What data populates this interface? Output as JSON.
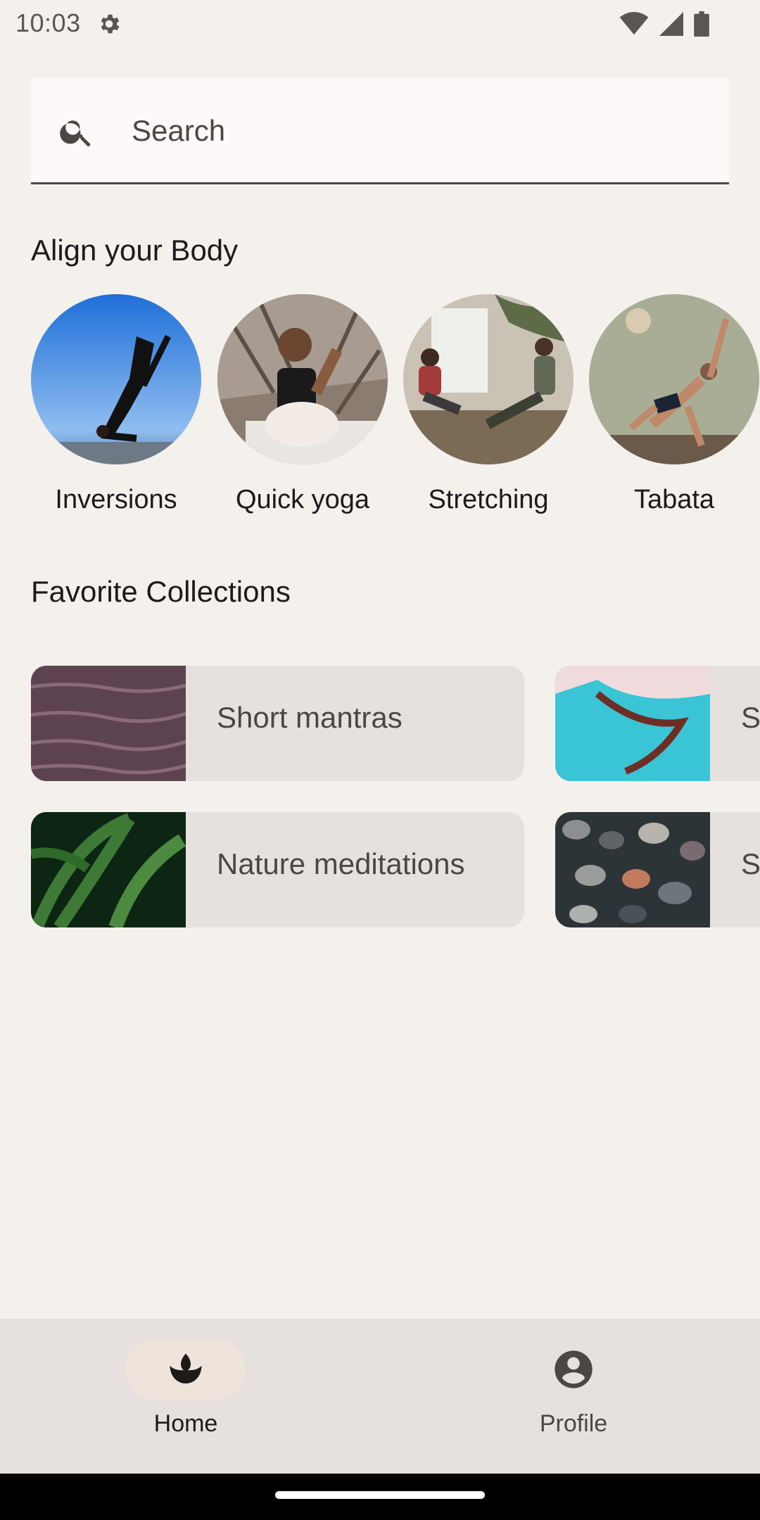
{
  "status_bar": {
    "time": "10:03",
    "icons": [
      "settings-icon",
      "wifi-icon",
      "cell-signal-icon",
      "battery-icon"
    ]
  },
  "search": {
    "placeholder": "Search",
    "value": ""
  },
  "align_section": {
    "title": "Align your Body",
    "items": [
      {
        "label": "Inversions"
      },
      {
        "label": "Quick yoga"
      },
      {
        "label": "Stretching"
      },
      {
        "label": "Tabata"
      }
    ]
  },
  "favorites_section": {
    "title": "Favorite Collections",
    "items": [
      {
        "label": "Short mantras"
      },
      {
        "label": "St"
      },
      {
        "label": "Nature meditations"
      },
      {
        "label": "Su"
      }
    ]
  },
  "bottom_nav": {
    "items": [
      {
        "label": "Home",
        "icon": "spa-icon",
        "selected": true
      },
      {
        "label": "Profile",
        "icon": "account-circle-icon",
        "selected": false
      }
    ]
  },
  "colors": {
    "background": "#f4f0ec",
    "surface": "#e6e1de",
    "text": "#1d1b1a",
    "text_secondary": "#4b4745"
  }
}
